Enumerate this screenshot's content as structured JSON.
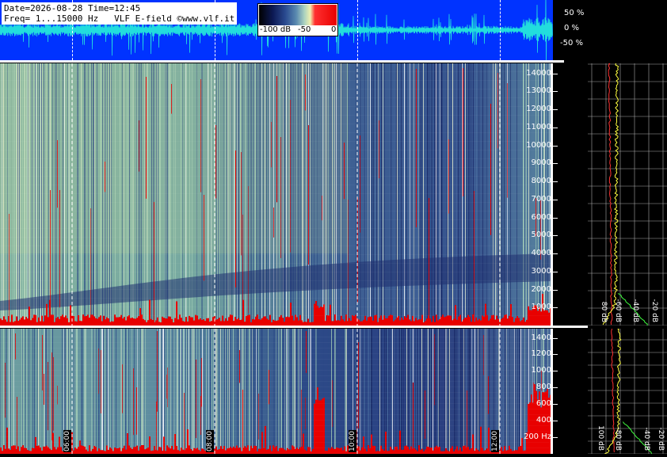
{
  "info": {
    "line1": "Date=2026-08-28 Time=12:45",
    "line2": "Freq= 1...15000 Hz   VLF E-field ©www.vlf.it"
  },
  "scale": {
    "labels": [
      "-100 dB",
      "-50",
      "0"
    ]
  },
  "wave_axis": {
    "labels": [
      "50 %",
      "0 %",
      "-50 %"
    ]
  },
  "upper_axis": {
    "labels": [
      "14000",
      "13000",
      "12000",
      "11000",
      "10000",
      "9000",
      "8000",
      "7000",
      "6000",
      "5000",
      "4000",
      "3000",
      "2000",
      "1000"
    ]
  },
  "lower_axis": {
    "labels": [
      "1400",
      "1200",
      "1000",
      "800",
      "600",
      "400",
      "200 Hz"
    ]
  },
  "upper_profile_db": [
    "80 dB",
    "-60 dB",
    "-40 dB",
    "-20 dB"
  ],
  "lower_profile_db": [
    "100 dB",
    "-80 dB",
    "-40 dB",
    "-20 dB"
  ],
  "time_markers": [
    "06:00",
    "08:00",
    "10:00",
    "12:00"
  ],
  "colors": {
    "wave_bg": "#0033ff",
    "wave_trace": "#22dddd",
    "hot": "#e80000",
    "profile_yellow": "#ffff40",
    "profile_red": "#ff3030",
    "profile_green": "#40ff40"
  }
}
